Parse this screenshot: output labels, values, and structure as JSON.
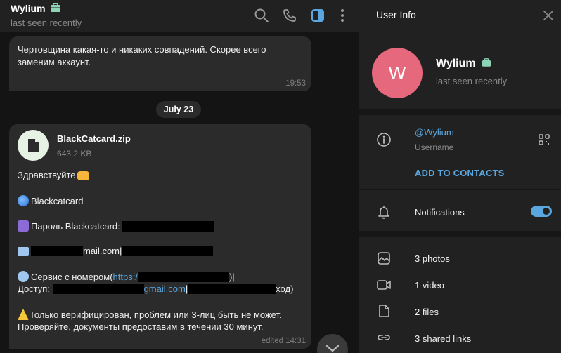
{
  "chat": {
    "name": "Wylium",
    "status": "last seen recently",
    "messages": {
      "first": {
        "text": "Чертовщина какая-то и никаких совпадений. Скорее всего заменим аккаунт.",
        "time": "19:53"
      },
      "date_separator": "July 23",
      "second": {
        "file_name": "BlackCatcard.zip",
        "file_size": "643.2 KB",
        "line_greeting": "Здравствуйте",
        "line_site": "Blackcatcard",
        "line_password": "Пароль Blackcatcard:",
        "line_mail": "mail.com",
        "line_mail_sep": "|",
        "line_service": "Сервис с номером(",
        "line_service_link": "https:/",
        "line_service_end": ")|",
        "line_access": "Доступ:",
        "line_access_mail": "gmail.com",
        "line_access_sep": "|",
        "line_access_end": "ход)",
        "line_warn1": "Только верифицирован, проблем или 3-лиц быть не может.",
        "line_warn2": "Проверяйте, документы предоставим в течении 30 минут.",
        "edited_time": "edited 14:31"
      }
    }
  },
  "panel": {
    "title": "User Info",
    "avatar_letter": "W",
    "name": "Wylium",
    "status": "last seen recently",
    "username": "@Wylium",
    "username_label": "Username",
    "add_contacts": "ADD TO CONTACTS",
    "notifications": "Notifications",
    "notifications_on": true,
    "media": {
      "photos": "3 photos",
      "video": "1 video",
      "files": "2 files",
      "links": "3 shared links"
    }
  },
  "colors": {
    "accent": "#5aa7e0",
    "avatar": "#e5687c",
    "badge": "#8fd3b6"
  }
}
